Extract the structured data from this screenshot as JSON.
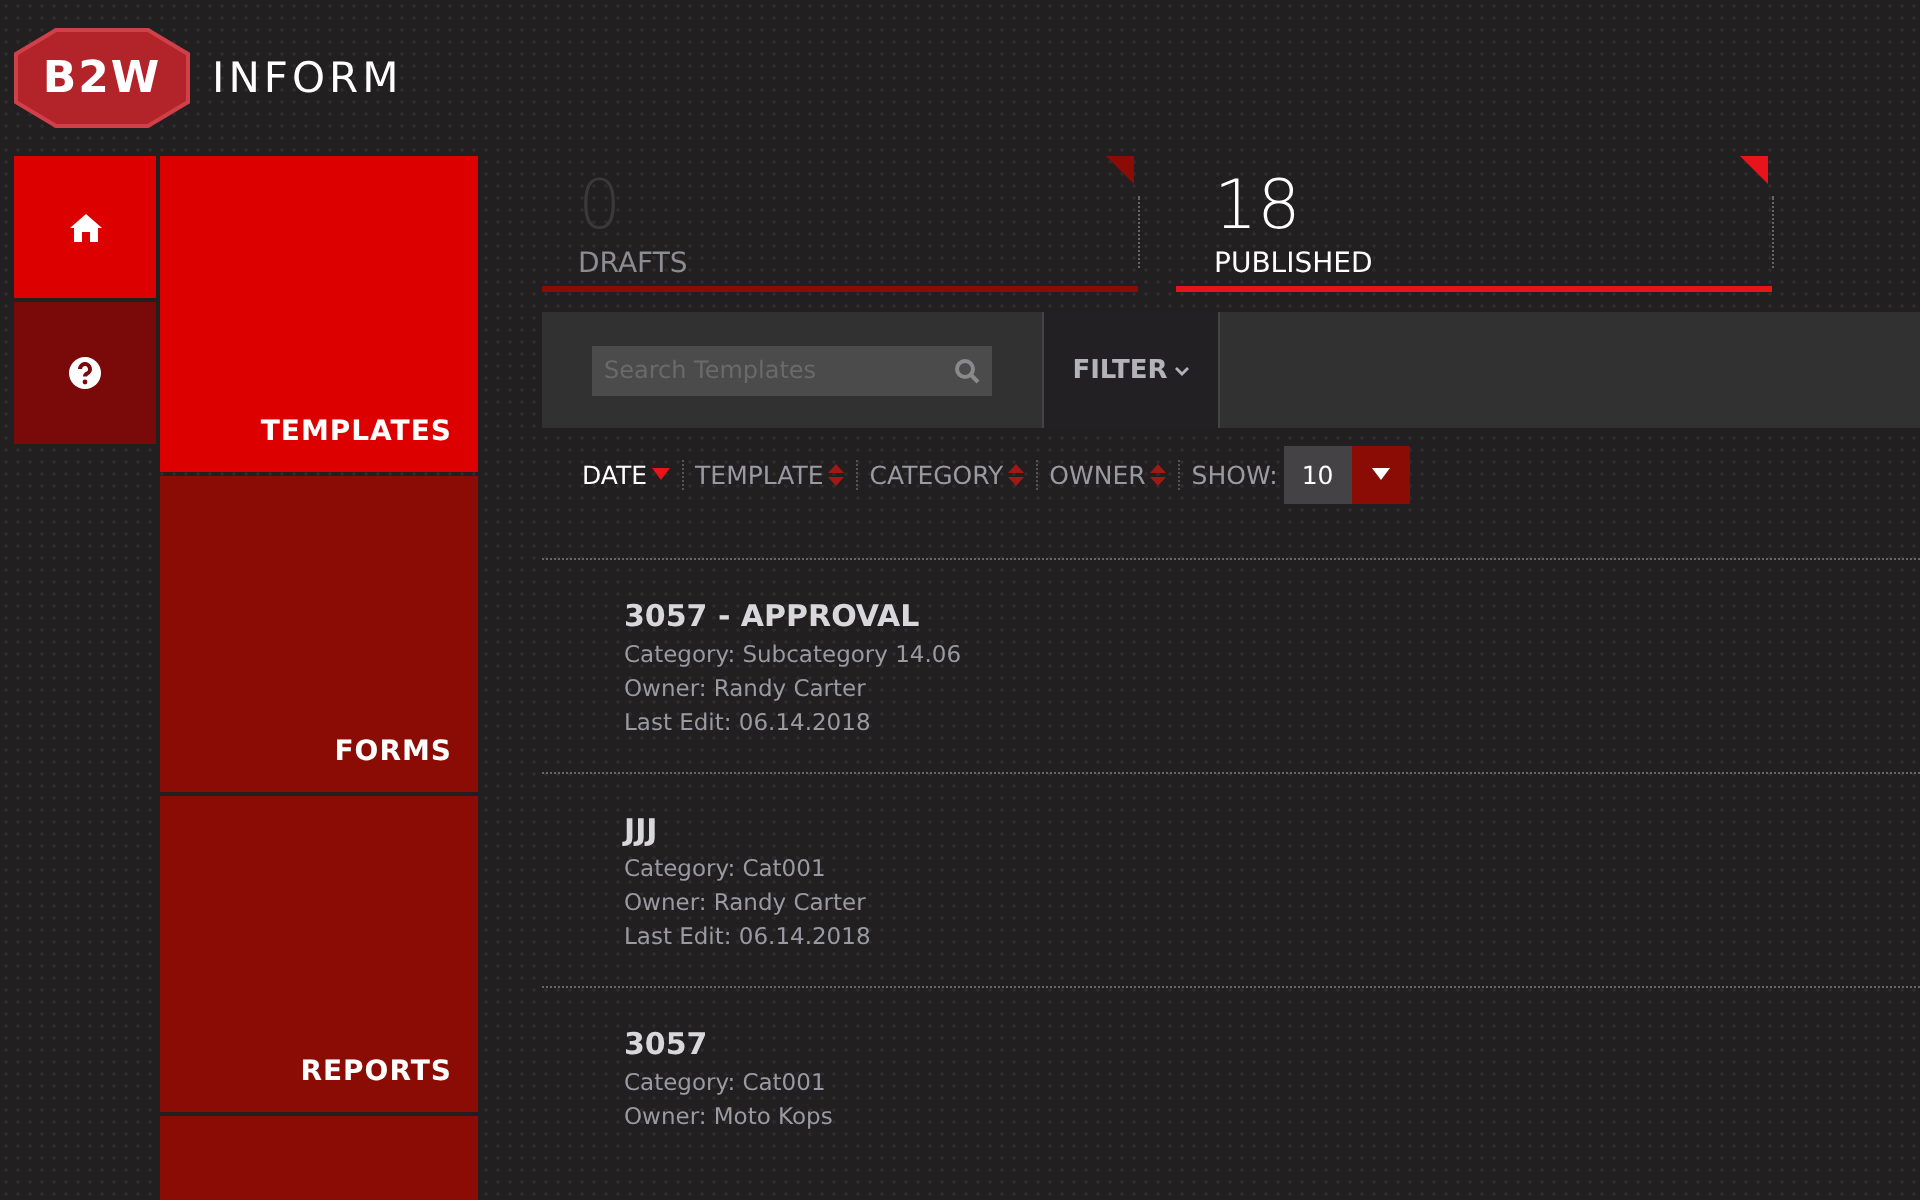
{
  "header": {
    "logo": "B2W",
    "title": "INFORM"
  },
  "side_buttons": [
    {
      "kind": "home",
      "selected": true
    },
    {
      "kind": "help",
      "selected": false
    }
  ],
  "nav": [
    {
      "label": "TEMPLATES",
      "selected": true
    },
    {
      "label": "FORMS",
      "selected": false
    },
    {
      "label": "REPORTS",
      "selected": false
    },
    {
      "selected": false
    }
  ],
  "stats": [
    {
      "count": "0",
      "label": "DRAFTS",
      "selected": false
    },
    {
      "count": "18",
      "label": "PUBLISHED",
      "selected": true
    }
  ],
  "toolbar": {
    "search": {
      "placeholder": "Search Templates"
    },
    "filter": "FILTER"
  },
  "sort": [
    {
      "label": "DATE",
      "selected": true
    },
    {
      "label": "TEMPLATE",
      "selected": false
    },
    {
      "label": "CATEGORY",
      "selected": false
    },
    {
      "label": "OWNER",
      "selected": false
    }
  ],
  "show": {
    "label": "SHOW:",
    "value": "10"
  },
  "templates": [
    {
      "title": "3057 - APPROVAL",
      "lines": [
        "Category: Subcategory 14.06",
        "Owner: Randy Carter",
        "Last Edit: 06.14.2018"
      ]
    },
    {
      "title": "JJJ",
      "lines": [
        "Category: Cat001",
        "Owner: Randy Carter",
        "Last Edit: 06.14.2018"
      ]
    },
    {
      "title": "3057",
      "lines": [
        "Category: Cat001",
        "Owner: Moto Kops"
      ]
    }
  ]
}
